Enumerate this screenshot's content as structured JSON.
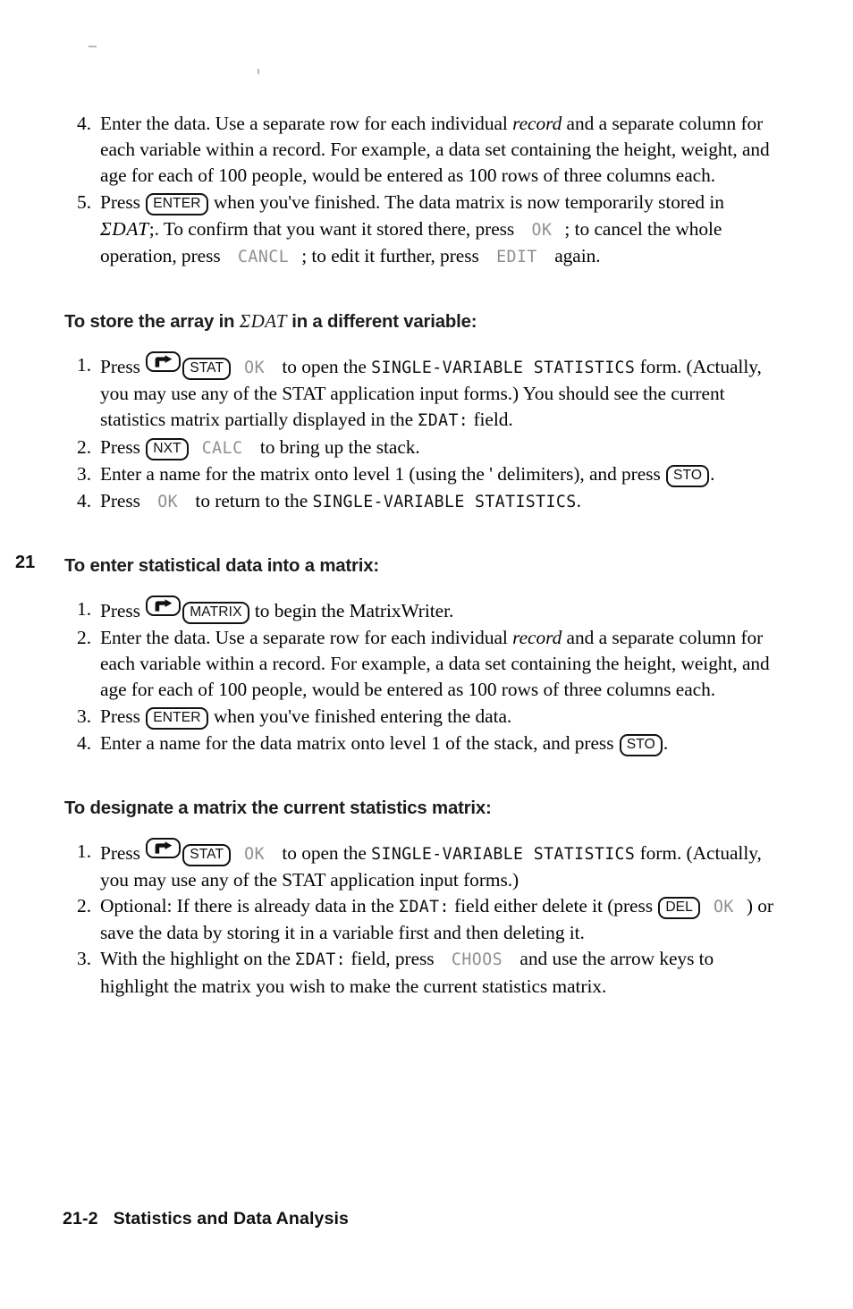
{
  "page": {
    "chapter_tab": "21",
    "footer": {
      "page_number": "21-2",
      "title": "Statistics and Data Analysis"
    }
  },
  "sections": [
    {
      "id": "continued-steps",
      "heading": null,
      "steps": [
        {
          "num": "4.",
          "parts": [
            {
              "t": "text",
              "v": "Enter the data. Use a separate row for each individual "
            },
            {
              "t": "em",
              "v": "record"
            },
            {
              "t": "text",
              "v": " and a separate column for each variable within a record. For example, a data set containing the height, weight, and age for each of 100 people, would be entered as 100 rows of three columns each."
            }
          ]
        },
        {
          "num": "5.",
          "parts": [
            {
              "t": "text",
              "v": "Press "
            },
            {
              "t": "key",
              "v": "ENTER"
            },
            {
              "t": "text",
              "v": " when you've finished. The data matrix is now temporarily stored in "
            },
            {
              "t": "math",
              "v": "ΣDAT"
            },
            {
              "t": "text",
              "v": ";. To confirm that you want it stored there, press "
            },
            {
              "t": "softkey",
              "v": "OK"
            },
            {
              "t": "text",
              "v": "; to cancel the whole operation, press "
            },
            {
              "t": "softkey",
              "v": "CANCL"
            },
            {
              "t": "text",
              "v": "; to edit it further, press "
            },
            {
              "t": "softkey",
              "v": "EDIT"
            },
            {
              "t": "text",
              "v": " again."
            }
          ]
        }
      ]
    },
    {
      "id": "store-array",
      "heading": {
        "before": "To store the array in ",
        "math": "ΣDAT",
        "after": " in a different variable:"
      },
      "steps": [
        {
          "num": "1.",
          "parts": [
            {
              "t": "text",
              "v": "Press "
            },
            {
              "t": "shiftkey",
              "v": "right-shift"
            },
            {
              "t": "key",
              "v": "STAT"
            },
            {
              "t": "softkey",
              "v": "OK"
            },
            {
              "t": "text",
              "v": " to open the "
            },
            {
              "t": "lcd",
              "v": "SINGLE-VARIABLE STATISTICS"
            },
            {
              "t": "text",
              "v": " form. (Actually, you may use any of the STAT application input forms.) You should see the current statistics matrix partially displayed in the "
            },
            {
              "t": "lcd",
              "v": "ΣDAT:"
            },
            {
              "t": "text",
              "v": " field."
            }
          ]
        },
        {
          "num": "2.",
          "parts": [
            {
              "t": "text",
              "v": "Press "
            },
            {
              "t": "key",
              "v": "NXT"
            },
            {
              "t": "softkey",
              "v": "CALC"
            },
            {
              "t": "text",
              "v": " to bring up the stack."
            }
          ]
        },
        {
          "num": "3.",
          "parts": [
            {
              "t": "text",
              "v": "Enter a name for the matrix onto level 1 (using the ' delimiters), and press "
            },
            {
              "t": "key",
              "v": "STO"
            },
            {
              "t": "text",
              "v": "."
            }
          ]
        },
        {
          "num": "4.",
          "parts": [
            {
              "t": "text",
              "v": "Press "
            },
            {
              "t": "softkey",
              "v": "OK"
            },
            {
              "t": "text",
              "v": " to return to the "
            },
            {
              "t": "lcd",
              "v": "SINGLE-VARIABLE STATISTICS"
            },
            {
              "t": "text",
              "v": "."
            }
          ]
        }
      ]
    },
    {
      "id": "enter-statistical-data",
      "heading": {
        "before": "To enter statistical data into a matrix:",
        "math": null,
        "after": null
      },
      "steps": [
        {
          "num": "1.",
          "parts": [
            {
              "t": "text",
              "v": "Press "
            },
            {
              "t": "shiftkey",
              "v": "right-shift"
            },
            {
              "t": "key",
              "v": "MATRIX"
            },
            {
              "t": "text",
              "v": " to begin the MatrixWriter."
            }
          ]
        },
        {
          "num": "2.",
          "parts": [
            {
              "t": "text",
              "v": "Enter the data. Use a separate row for each individual "
            },
            {
              "t": "em",
              "v": "record"
            },
            {
              "t": "text",
              "v": " and a separate column for each variable within a record. For example, a data set containing the height, weight, and age for each of 100 people, would be entered as 100 rows of three columns each."
            }
          ]
        },
        {
          "num": "3.",
          "parts": [
            {
              "t": "text",
              "v": "Press "
            },
            {
              "t": "key",
              "v": "ENTER"
            },
            {
              "t": "text",
              "v": " when you've finished entering the data."
            }
          ]
        },
        {
          "num": "4.",
          "parts": [
            {
              "t": "text",
              "v": "Enter a name for the data matrix onto level 1 of the stack, and press "
            },
            {
              "t": "key",
              "v": "STO"
            },
            {
              "t": "text",
              "v": "."
            }
          ]
        }
      ]
    },
    {
      "id": "designate-matrix",
      "heading": {
        "before": "To designate a matrix the current statistics matrix:",
        "math": null,
        "after": null
      },
      "steps": [
        {
          "num": "1.",
          "parts": [
            {
              "t": "text",
              "v": "Press "
            },
            {
              "t": "shiftkey",
              "v": "right-shift"
            },
            {
              "t": "key",
              "v": "STAT"
            },
            {
              "t": "softkey",
              "v": "OK"
            },
            {
              "t": "text",
              "v": " to open the "
            },
            {
              "t": "lcd",
              "v": "SINGLE-VARIABLE STATISTICS"
            },
            {
              "t": "text",
              "v": " form. (Actually, you may use any of the STAT application input forms.)"
            }
          ]
        },
        {
          "num": "2.",
          "parts": [
            {
              "t": "text",
              "v": "Optional: If there is already data in the "
            },
            {
              "t": "lcd",
              "v": "ΣDAT:"
            },
            {
              "t": "text",
              "v": " field either delete it (press "
            },
            {
              "t": "key",
              "v": "DEL"
            },
            {
              "t": "softkey",
              "v": "OK"
            },
            {
              "t": "text",
              "v": ") or save the data by storing it in a variable first and then deleting it."
            }
          ]
        },
        {
          "num": "3.",
          "parts": [
            {
              "t": "text",
              "v": "With the highlight on the "
            },
            {
              "t": "lcd",
              "v": "ΣDAT:"
            },
            {
              "t": "text",
              "v": " field, press "
            },
            {
              "t": "softkey",
              "v": "CHOOS"
            },
            {
              "t": "text",
              "v": " and use the arrow keys to highlight the matrix you wish to make the current statistics matrix."
            }
          ]
        }
      ]
    }
  ]
}
